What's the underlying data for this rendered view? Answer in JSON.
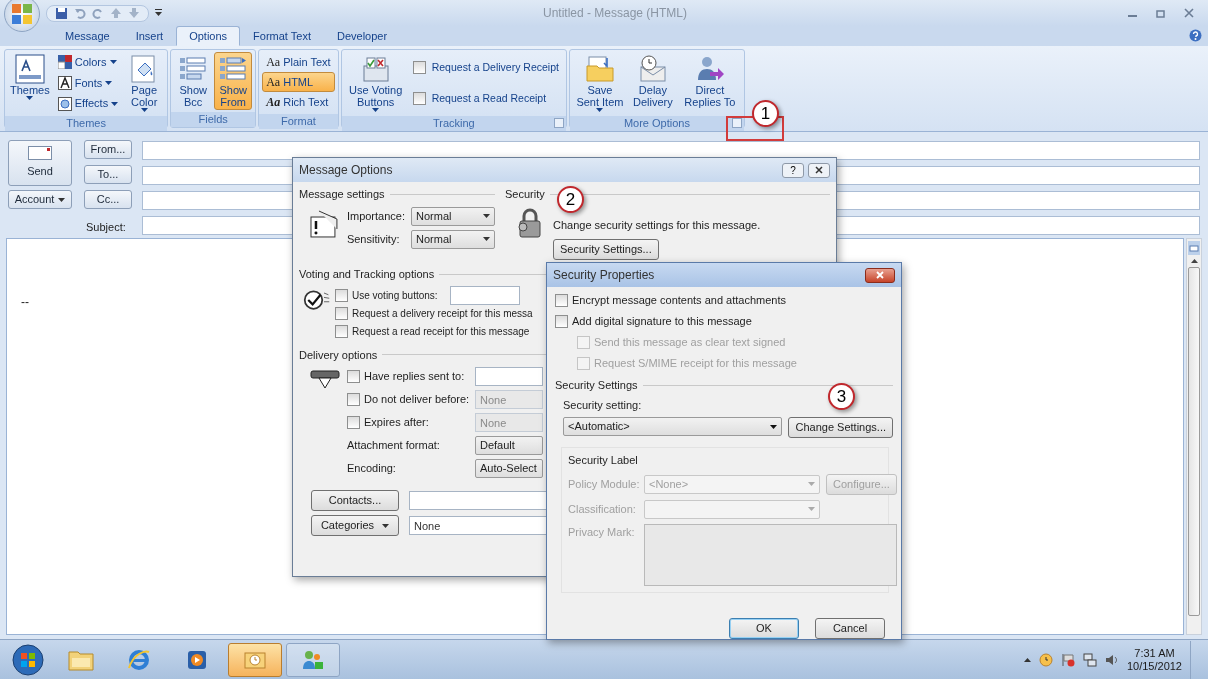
{
  "window": {
    "title": "Untitled - Message (HTML)"
  },
  "tabs": [
    {
      "label": "Message",
      "selected": false
    },
    {
      "label": "Insert",
      "selected": false
    },
    {
      "label": "Options",
      "selected": true
    },
    {
      "label": "Format Text",
      "selected": false
    },
    {
      "label": "Developer",
      "selected": false
    }
  ],
  "ribbon_groups": [
    {
      "label": "Themes",
      "items": [
        {
          "kind": "large",
          "label": "Themes",
          "dropdown": true,
          "selected": false
        },
        {
          "kind": "small",
          "label": "Colors",
          "dropdown": true,
          "selected": false
        },
        {
          "kind": "small",
          "label": "Fonts",
          "dropdown": true,
          "selected": false
        },
        {
          "kind": "small",
          "label": "Effects",
          "dropdown": true,
          "selected": false
        },
        {
          "kind": "large",
          "label": "Page Color",
          "dropdown": true,
          "selected": false
        }
      ]
    },
    {
      "label": "Fields",
      "items": [
        {
          "kind": "large",
          "label": "Show Bcc",
          "selected": false
        },
        {
          "kind": "large",
          "label": "Show From",
          "selected": true
        }
      ]
    },
    {
      "label": "Format",
      "items": [
        {
          "kind": "small",
          "glyph": "Aa",
          "label": "Plain Text",
          "selected": false
        },
        {
          "kind": "small",
          "glyph": "Aa",
          "label": "HTML",
          "selected": true
        },
        {
          "kind": "small",
          "glyph": "Aa",
          "label": "Rich Text",
          "selected": false
        }
      ]
    },
    {
      "label": "Tracking",
      "launcher": true,
      "items": [
        {
          "kind": "large",
          "label": "Use Voting Buttons",
          "dropdown": true,
          "selected": false
        },
        {
          "kind": "check",
          "label": "Request a Delivery Receipt",
          "checked": false
        },
        {
          "kind": "check",
          "label": "Request a Read Receipt",
          "checked": false
        }
      ]
    },
    {
      "label": "More Options",
      "launcher": true,
      "items": [
        {
          "kind": "large",
          "label": "Save Sent Item",
          "dropdown": true,
          "selected": false
        },
        {
          "kind": "large",
          "label": "Delay Delivery",
          "selected": false
        },
        {
          "kind": "large",
          "label": "Direct Replies To",
          "selected": false
        }
      ]
    }
  ],
  "compose": {
    "send": "Send",
    "account": "Account",
    "address_buttons": [
      "From...",
      "To...",
      "Cc..."
    ],
    "subject_label": "Subject:",
    "body": "--"
  },
  "message_options": {
    "title": "Message Options",
    "help": "?",
    "message_settings": {
      "legend": "Message settings",
      "rows": [
        {
          "label": "Importance:",
          "value": "Normal"
        },
        {
          "label": "Sensitivity:",
          "value": "Normal"
        }
      ]
    },
    "security": {
      "legend": "Security",
      "text": "Change security settings for this message.",
      "button": "Security Settings..."
    },
    "voting": {
      "legend": "Voting and Tracking options",
      "checks": [
        {
          "label": "Use voting buttons:",
          "checked": false,
          "field": true
        },
        {
          "label": "Request a delivery receipt for this messa",
          "checked": false,
          "field": false
        },
        {
          "label": "Request a read receipt for this message",
          "checked": false,
          "field": false
        }
      ]
    },
    "delivery": {
      "legend": "Delivery options",
      "rows": [
        {
          "kind": "check",
          "label": "Have replies sent to:",
          "checked": false,
          "value": "",
          "disabled": false
        },
        {
          "kind": "check",
          "label": "Do not deliver before:",
          "checked": false,
          "value": "None",
          "disabled": true
        },
        {
          "kind": "check",
          "label": "Expires after:",
          "checked": false,
          "value": "None",
          "disabled": true
        },
        {
          "kind": "select",
          "label": "Attachment format:",
          "value": "Default"
        },
        {
          "kind": "select",
          "label": "Encoding:",
          "value": "Auto-Select"
        }
      ]
    },
    "contacts_button": "Contacts...",
    "categories_button": "Categories",
    "categories_value": "None"
  },
  "security_properties": {
    "title": "Security Properties",
    "checks": [
      {
        "label": "Encrypt message contents and attachments",
        "checked": false,
        "disabled": false,
        "indent": false
      },
      {
        "label": "Add digital signature to this message",
        "checked": false,
        "disabled": false,
        "indent": false
      },
      {
        "label": "Send this message as clear text signed",
        "checked": false,
        "disabled": true,
        "indent": true
      },
      {
        "label": "Request S/MIME receipt for this message",
        "checked": false,
        "disabled": true,
        "indent": true
      }
    ],
    "settings_legend": "Security Settings",
    "setting_label": "Security setting:",
    "setting_value": "<Automatic>",
    "change_button": "Change Settings...",
    "label_group": {
      "legend": "Security Label",
      "disabled": true,
      "policy_label": "Policy Module:",
      "policy_value": "<None>",
      "configure_button": "Configure...",
      "classification_label": "Classification:",
      "privacy_label": "Privacy Mark:"
    },
    "ok": "OK",
    "cancel": "Cancel"
  },
  "callouts": [
    "1",
    "2",
    "3"
  ],
  "taskbar": {
    "apps": [
      {
        "selected": false
      },
      {
        "selected": false
      },
      {
        "selected": false
      },
      {
        "selected": true
      },
      {
        "selected": false
      }
    ],
    "time": "7:31 AM",
    "date": "10/15/2012"
  }
}
